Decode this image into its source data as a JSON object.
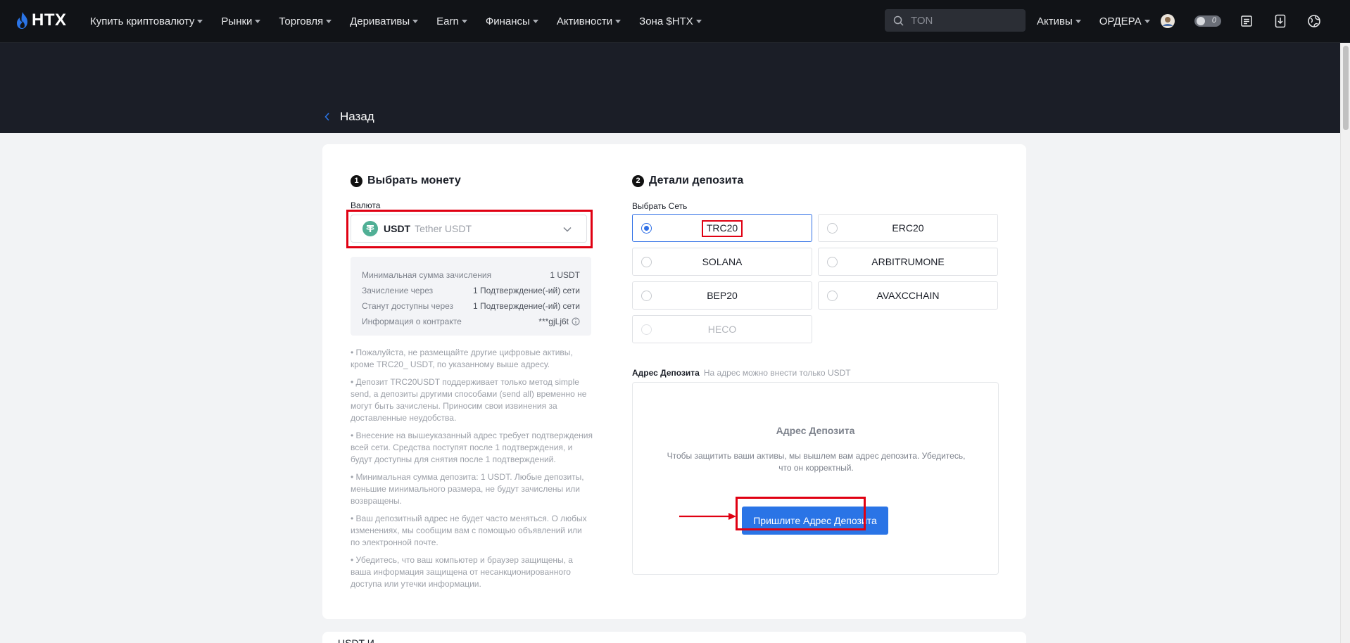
{
  "brand": {
    "logo_text": "HTX"
  },
  "nav": {
    "items": [
      {
        "label": "Купить криптовалюту"
      },
      {
        "label": "Рынки"
      },
      {
        "label": "Торговля"
      },
      {
        "label": "Деривативы"
      },
      {
        "label": "Earn"
      },
      {
        "label": "Финансы"
      },
      {
        "label": "Активности"
      },
      {
        "label": "Зона $HTX"
      }
    ],
    "search_placeholder": "TON",
    "assets_label": "Активы",
    "orders_label": "ОРДЕРА",
    "toggle_badge": "0"
  },
  "header": {
    "back_label": "Назад"
  },
  "step1": {
    "number": "1",
    "title": "Выбрать монету",
    "currency_label": "Валюта",
    "coin_symbol": "USDT",
    "coin_name": "Tether USDT",
    "info": [
      {
        "label": "Минимальная сумма зачисления",
        "value": "1 USDT"
      },
      {
        "label": "Зачисление через",
        "value": "1 Подтверждение(-ий) сети"
      },
      {
        "label": "Станут доступны через",
        "value": "1 Подтверждение(-ий) сети"
      },
      {
        "label": "Информация о контракте",
        "value": "***gjLj6t"
      }
    ],
    "notes": [
      "• Пожалуйста, не размещайте другие цифровые активы, кроме TRC20_ USDT, по указанному выше адресу.",
      "• Депозит TRC20USDT поддерживает только метод simple send, а депозиты другими способами (send all) временно не могут быть зачислены. Приносим свои извинения за доставленные неудобства.",
      "• Внесение на вышеуказанный адрес требует подтверждения всей сети. Средства поступят после 1 подтверждения, и будут доступны для снятия после 1 подтверждений.",
      "• Минимальная сумма депозита: 1 USDT. Любые депозиты, меньшие минимального размера, не будут зачислены или возвращены.",
      "• Ваш депозитный адрес не будет часто меняться. О любых изменениях, мы сообщим вам с помощью объявлений или по электронной почте.",
      "• Убедитесь, что ваш компьютер и браузер защищены, а ваша информация защищена от несанкционированного доступа или утечки информации."
    ]
  },
  "step2": {
    "number": "2",
    "title": "Детали депозита",
    "network_label": "Выбрать Сеть",
    "networks": [
      {
        "label": "TRC20",
        "selected": true,
        "disabled": false
      },
      {
        "label": "ERC20",
        "selected": false,
        "disabled": false
      },
      {
        "label": "SOLANA",
        "selected": false,
        "disabled": false
      },
      {
        "label": "ARBITRUMONE",
        "selected": false,
        "disabled": false
      },
      {
        "label": "BEP20",
        "selected": false,
        "disabled": false
      },
      {
        "label": "AVAXCCHAIN",
        "selected": false,
        "disabled": false
      },
      {
        "label": "HECO",
        "selected": false,
        "disabled": true
      }
    ],
    "address_label": "Адрес Депозита",
    "address_hint": "На адрес можно внести только USDT",
    "address_title": "Адрес Депозита",
    "address_desc": "Чтобы защитить ваши активы, мы вышлем вам адрес депозита. Убедитесь, что он корректный.",
    "button_label": "Пришлите Адрес Депозита"
  },
  "bottom_card": {
    "title": "USDT И..."
  },
  "colors": {
    "accent": "#2a74e6",
    "highlight": "#e00012",
    "tether": "#50af95",
    "nav_bg": "#111317"
  }
}
